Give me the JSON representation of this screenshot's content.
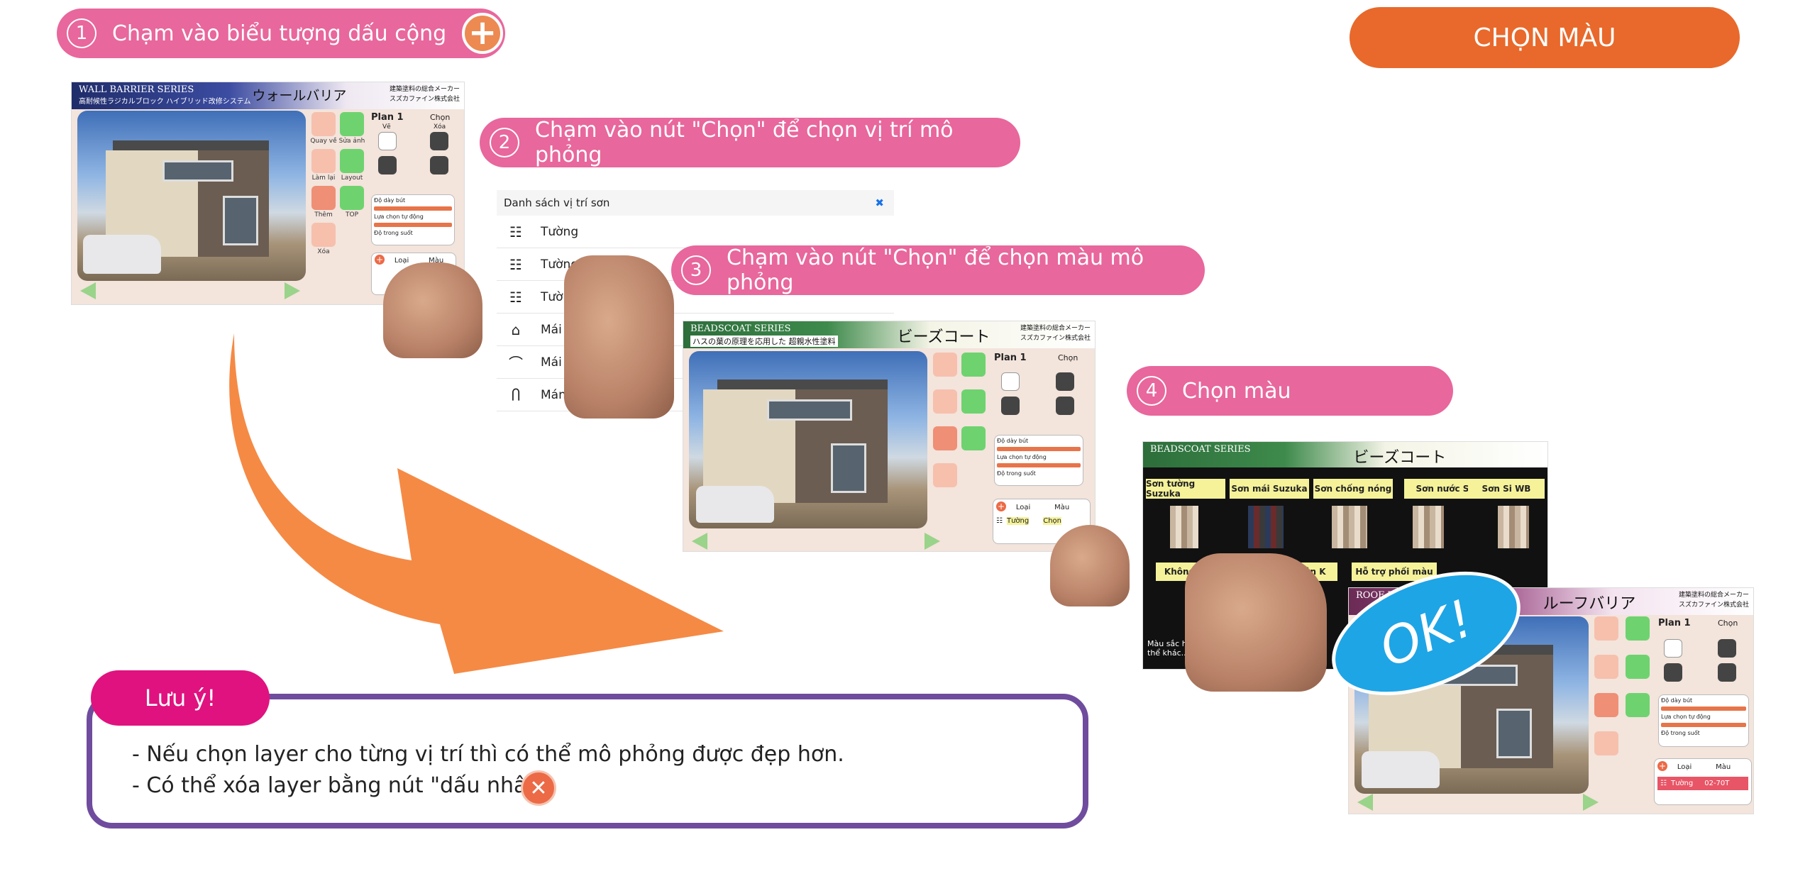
{
  "steps": [
    {
      "number": "1",
      "text": "Chạm vào biểu tượng dấu cộng"
    },
    {
      "number": "2",
      "text": "Chạm vào nút \"Chọn\" để chọn vị trí mô phỏng"
    },
    {
      "number": "3",
      "text": "Chạm vào nút \"Chọn\" để chọn màu mô phỏng"
    },
    {
      "number": "4",
      "text": "Chọn màu"
    }
  ],
  "header_button": "CHỌN MÀU",
  "screens": {
    "wall": {
      "series": "WALL BARRIER SERIES",
      "title": "ウォールバリア",
      "company": "建築塗料の総合メーカー スズカファイン株式会社",
      "sub": "高耐候性ラジカルブロック ハイブリッド改修システム"
    },
    "beads": {
      "series": "BEADSCOAT SERIES",
      "title": "ビーズコート",
      "company": "建築塗料の総合メーカー スズカファイン株式会社",
      "sub": "ハスの葉の原理を応用した 超親水性塗料"
    },
    "roof": {
      "series": "ROOF BARRIER SERIES",
      "title": "ルーフバリア",
      "company": "建築塗料の総合メーカー スズカファイン株式会社"
    }
  },
  "app": {
    "plan": "Plan 1",
    "select_btn": "Chọn",
    "draw": "Vẽ",
    "delete": "Xóa",
    "undo": "Quay về",
    "edit": "Sửa ảnh",
    "redo": "Làm lại",
    "layout": "Layout",
    "add": "Thêm",
    "top": "TOP",
    "erase": "Xóa",
    "brush_size": "Độ dày bút",
    "auto_select": "Lựa chọn tự động",
    "transparency": "Độ trong suốt",
    "col_type": "Loại",
    "col_color": "Màu",
    "layer_wall": "Tường",
    "layer_select": "Chọn",
    "layer_code": "02-70T"
  },
  "location_list": {
    "title": "Danh sách vị trí sơn",
    "items": [
      {
        "icon": "brick-wall-icon",
        "glyph": "☷",
        "label": "Tường"
      },
      {
        "icon": "brick-wall-icon",
        "glyph": "☷",
        "label": "Tường"
      },
      {
        "icon": "brick-wall-icon",
        "glyph": "☷",
        "label": "Tường"
      },
      {
        "icon": "roof-icon",
        "glyph": "⌂",
        "label": "Mái"
      },
      {
        "icon": "eaves-icon",
        "glyph": "⌒",
        "label": "Mái hiên"
      },
      {
        "icon": "gutter-icon",
        "glyph": "Ⴖ",
        "label": "Máng nước"
      }
    ]
  },
  "color_menu": {
    "items": [
      "Sơn tường Suzuka",
      "Sơn mái Suzuka",
      "Sơn chống nóng",
      "Sơn nước Si",
      "Sơn Si WB"
    ],
    "items2": [
      "Không ...màu",
      "Phiên bản K",
      "Hỗ trợ phối màu"
    ],
    "note": "Màu sắc hiể... có thể khác..."
  },
  "ok_label": "OK!",
  "note": {
    "title": "Lưu ý!",
    "lines": [
      "- Nếu chọn layer cho từng vị trí thì có thể mô phỏng được đẹp hơn.",
      "- Có thể xóa layer bằng nút \"dấu nhân\""
    ]
  },
  "colors": {
    "pink": "#e8679c",
    "orange": "#e8692b",
    "arrow": "#f58a45",
    "purple": "#6f4c9e",
    "magenta": "#e0127f",
    "ok_blue": "#1ea5e6"
  }
}
